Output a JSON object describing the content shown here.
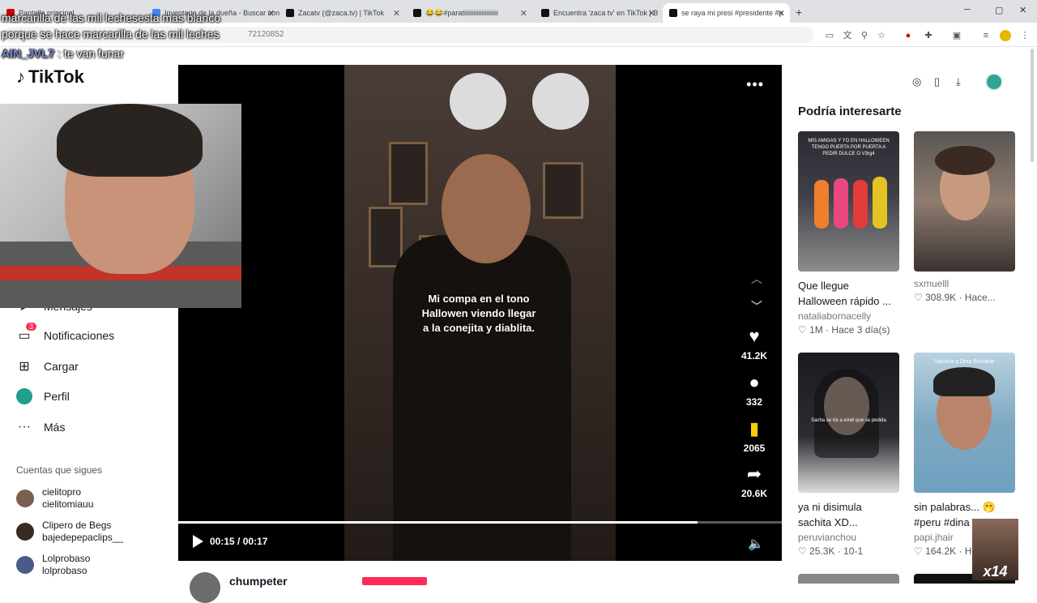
{
  "browser": {
    "tabs": [
      {
        "label": "Pantalla principal",
        "active": false
      },
      {
        "label": "Inventario de la dueña - Buscar con G",
        "active": false
      },
      {
        "label": "Zacatv (@zaca.tv) | TikTok",
        "active": false
      },
      {
        "label": "😂😂#paratiiiiiiiiiiiiiiiiiiiii",
        "active": false
      },
      {
        "label": "Encuentra 'zaca tv' en TikTok | B",
        "active": false
      },
      {
        "label": "se raya mi presi #presidente #p",
        "active": true
      }
    ],
    "url": "72120852"
  },
  "overlay": {
    "line1": "marcarilla de las mil lechesesta mas blanco",
    "line2": "porque se hace marcarilla de las mil leches",
    "chat_user": "AIN_JVL7",
    "chat_message": " : te van funar",
    "counter_badge": "x14"
  },
  "sidebar": {
    "logo": "TikTok",
    "nav": {
      "partial": "Mensajes",
      "notifications": "Notificaciones",
      "notifications_badge": "3",
      "upload": "Cargar",
      "profile": "Perfil",
      "more": "Más"
    },
    "following_title": "Cuentas que sigues",
    "following": [
      {
        "name": "cielitopro",
        "handle": "cielitomiauu"
      },
      {
        "name": "Clipero de Begs",
        "handle": "bajedepepaclips__"
      },
      {
        "name": "Lolprobaso",
        "handle": "lolprobaso"
      }
    ]
  },
  "video": {
    "caption": "Mi compa en el tono Hallowen viendo llegar a la conejita y diablita.",
    "likes": "41.2K",
    "comments": "332",
    "saves": "2065",
    "shares": "20.6K",
    "time": "00:15 / 00:17",
    "progress": 0.86,
    "author": "chumpeter"
  },
  "recommendations": {
    "title": "Podría interesarte",
    "cards": [
      {
        "desc": "Que llegue\nHalloween rápido ...",
        "author": "nataliabornacelly",
        "meta": "♡ 1M  ·  Hace 3 día(s)",
        "thumb_text": "MIS AMIGAS Y YO EN HALLOWEEN TENGO PUERTA POR PUERTA A PEDIR DULCE O V3rg4"
      },
      {
        "desc": "",
        "author": "sxmuelll",
        "meta": "♡ 308.9K  ·  Hace...",
        "thumb_text": ""
      },
      {
        "desc": "ya ni disimula\nsachita XD...",
        "author": "peruvianchou",
        "meta": "♡ 25.3K  ·  10-1",
        "thumb_text": "Sacha se ríe a emel que se pedida"
      },
      {
        "desc": "sin palabras... 🫢\n#peru #dina",
        "author": "papi.jhair",
        "meta": "♡ 164.2K  ·  H",
        "thumb_text": "Vacuna a Dina Boluarte"
      }
    ]
  },
  "colors": {
    "accent": "#fe2c55",
    "save": "#facd00"
  }
}
